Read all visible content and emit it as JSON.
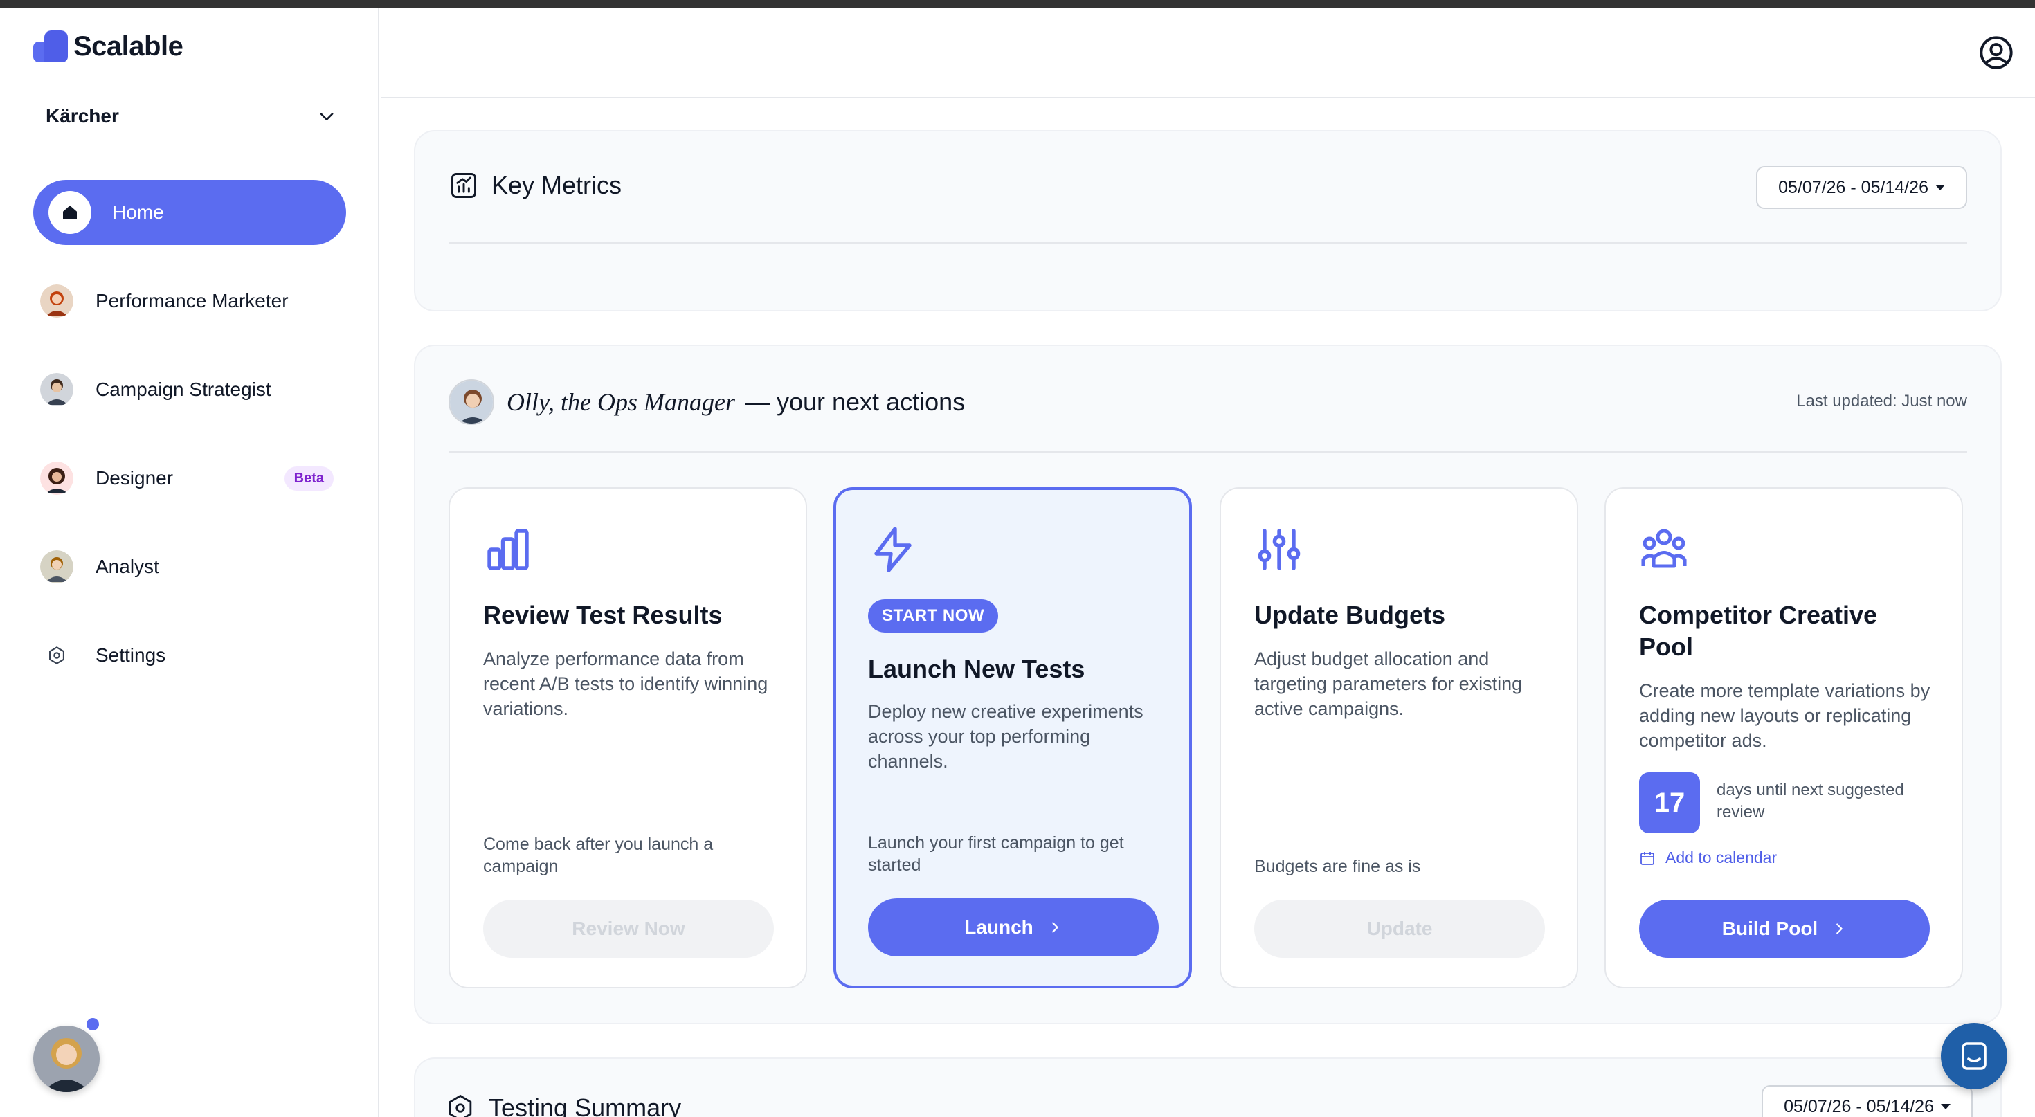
{
  "brand": {
    "name": "Scalable",
    "accent": "#5b6cf0"
  },
  "org": {
    "selected": "Kärcher"
  },
  "sidebar": {
    "items": [
      {
        "label": "Home",
        "active": true
      },
      {
        "label": "Performance Marketer"
      },
      {
        "label": "Campaign Strategist"
      },
      {
        "label": "Designer",
        "badge": "Beta"
      },
      {
        "label": "Analyst"
      },
      {
        "label": "Settings"
      }
    ]
  },
  "metrics": {
    "title": "Key Metrics",
    "date_range": "05/07/26 - 05/14/26"
  },
  "actions": {
    "persona": "Olly, the Ops Manager",
    "suffix": "— your next actions",
    "last_updated": "Last updated: Just now",
    "cards": [
      {
        "title": "Review Test Results",
        "description": "Analyze performance data from recent A/B tests to identify winning variations.",
        "note": "Come back after you launch a campaign",
        "button": "Review Now"
      },
      {
        "badge": "START NOW",
        "title": "Launch New Tests",
        "description": "Deploy new creative experiments across your top performing channels.",
        "note": "Launch your first campaign to get started",
        "button": "Launch"
      },
      {
        "title": "Update Budgets",
        "description": "Adjust budget allocation and targeting parameters for existing active campaigns.",
        "note": "Budgets are fine as is",
        "button": "Update"
      },
      {
        "title": "Competitor Creative Pool",
        "description": "Create more template variations by adding new layouts or replicating competitor ads.",
        "days": "17",
        "days_text": "days until next suggested review",
        "calendar_link": "Add to calendar",
        "button": "Build Pool"
      }
    ]
  },
  "testing": {
    "title": "Testing Summary",
    "date_range": "05/07/26 - 05/14/26"
  }
}
